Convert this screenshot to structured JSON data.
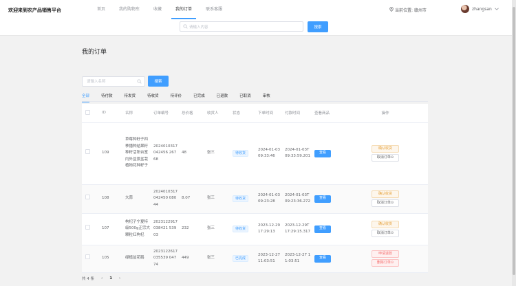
{
  "app": {
    "title": "欢迎来到农产品销售平台"
  },
  "nav": {
    "items": [
      {
        "label": "首页"
      },
      {
        "label": "我的购物车"
      },
      {
        "label": "收藏"
      },
      {
        "label": "我的订单"
      },
      {
        "label": "联系客服"
      }
    ],
    "active_index": 3
  },
  "location": {
    "text": "当前位置: 赣州市"
  },
  "user": {
    "name": "zhangsan"
  },
  "top_search": {
    "placeholder": "请输入内容",
    "button": "搜索"
  },
  "page": {
    "title": "我的订单"
  },
  "filter": {
    "placeholder": "请输入名称",
    "button": "搜索"
  },
  "tabs": {
    "items": [
      {
        "label": "全部"
      },
      {
        "label": "待付款"
      },
      {
        "label": "待发货"
      },
      {
        "label": "待收货"
      },
      {
        "label": "待评价"
      },
      {
        "label": "已完成"
      },
      {
        "label": "已退款"
      },
      {
        "label": "已取消"
      },
      {
        "label": "审核"
      }
    ],
    "active_index": 0
  },
  "table": {
    "headers": [
      "",
      "ID",
      "名称",
      "订单编号",
      "总价格",
      "收货人",
      "状态",
      "下单时间",
      "付款时间",
      "查看商品",
      "操作"
    ],
    "rows": [
      {
        "id": "109",
        "name": "草莓种籽子四季播种结果籽种籽活阳台室内外盆景盆栽植物花种籽子",
        "order_no": "2024010317042456 26768",
        "total": "48",
        "receiver": "张三",
        "status": "待收货",
        "order_time": "2024-01-03 09:33:46",
        "pay_time": "2024-01-03T09:33:59.201",
        "view": "查看",
        "ops": [
          {
            "label": "确认收货",
            "style": "warn"
          },
          {
            "label": "取消订单⊙",
            "style": "plain"
          }
        ]
      },
      {
        "id": "108",
        "name": "大蒜",
        "order_no": "2024010317042450 08044",
        "total": "8.07",
        "receiver": "张三",
        "status": "待收货",
        "order_time": "2024-01-03 09:23:28",
        "pay_time": "2024-01-03T09:23:36.272",
        "view": "查看",
        "ops": [
          {
            "label": "确认收货",
            "style": "warn"
          },
          {
            "label": "取消订单⊙",
            "style": "plain"
          }
        ]
      },
      {
        "id": "107",
        "name": "枸杞子宁夏特级500g正宗大颗粒红枸杞",
        "order_no": "2023122917038421 53903",
        "total": "232",
        "receiver": "张三",
        "status": "待收货",
        "order_time": "2023-12-29 17:29:13",
        "pay_time": "2023-12-29T17:29:15.317",
        "view": "查看",
        "ops": [
          {
            "label": "确认收货",
            "style": "warn"
          },
          {
            "label": "取消订单⊙",
            "style": "plain"
          }
        ]
      },
      {
        "id": "105",
        "name": "绿植盆花鹅",
        "order_no": "2023122617035539 04774",
        "total": "449",
        "receiver": "张三",
        "status": "已完成",
        "order_time": "2023-12-27 11:03:51",
        "pay_time": "2023-12-27 11:03:51",
        "view": "查看",
        "ops": [
          {
            "label": "申请退款",
            "style": "danger"
          },
          {
            "label": "删除订单⊙",
            "style": "danger"
          }
        ]
      }
    ]
  },
  "pagination": {
    "total_text": "共 4 条",
    "prev": "‹",
    "page": "1",
    "next": "›"
  },
  "colors": {
    "primary": "#409eff",
    "warning": "#e6a23c",
    "danger": "#f56c6c"
  }
}
